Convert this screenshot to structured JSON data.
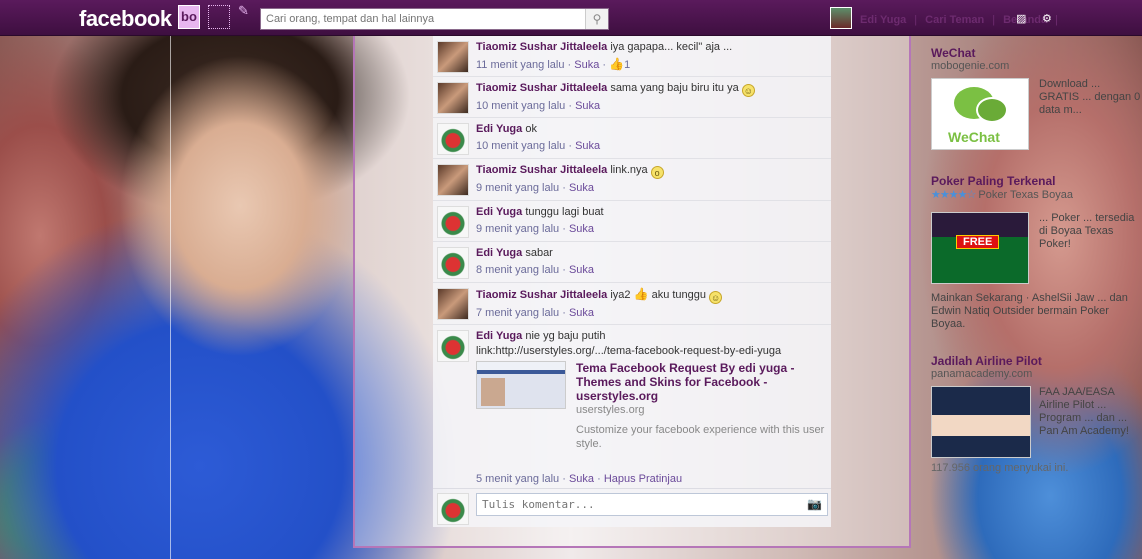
{
  "topbar": {
    "logo": "facebook",
    "friend_jewel": "bo",
    "search_placeholder": "Cari orang, tempat dan hal lainnya",
    "user_name": "Edi Yuga",
    "nav_find_friends": "Cari Teman",
    "nav_home": "Beranda",
    "icons": [
      "friend-requests-icon",
      "messages-icon",
      "notifications-icon",
      "search-icon",
      "privacy-icon",
      "settings-icon"
    ]
  },
  "comments": [
    {
      "author": "Tiaomiz Sushar Jittaleela",
      "text": "iya gapapa... kecil\" aja ...",
      "time": "11 menit yang lalu",
      "like": "Suka",
      "likes": "1",
      "avatar": "t"
    },
    {
      "author": "Tiaomiz Sushar Jittaleela",
      "text": "sama yang baju biru itu ya",
      "time": "10 menit yang lalu",
      "like": "Suka",
      "avatar": "t"
    },
    {
      "author": "Edi Yuga",
      "text": "ok",
      "time": "10 menit yang lalu",
      "like": "Suka",
      "avatar": "e"
    },
    {
      "author": "Tiaomiz Sushar Jittaleela",
      "text": "link.nya",
      "time": "9 menit yang lalu",
      "like": "Suka",
      "avatar": "t"
    },
    {
      "author": "Edi Yuga",
      "text": "tunggu lagi buat",
      "time": "9 menit yang lalu",
      "like": "Suka",
      "avatar": "e"
    },
    {
      "author": "Edi Yuga",
      "text": "sabar",
      "time": "8 menit yang lalu",
      "like": "Suka",
      "avatar": "e"
    },
    {
      "author": "Tiaomiz Sushar Jittaleela",
      "text": "iya2",
      "text2": "aku tunggu",
      "time": "7 menit yang lalu",
      "like": "Suka",
      "avatar": "t"
    },
    {
      "author": "Edi Yuga",
      "text": "nie yg baju putih",
      "link_text": "link:http://userstyles.org/.../tema-facebook-request-by-edi-yuga",
      "time": "5 menit yang lalu",
      "like": "Suka",
      "remove_preview": "Hapus Pratinjau",
      "avatar": "e",
      "preview": {
        "title": "Tema Facebook Request By edi yuga - Themes and Skins for Facebook - userstyles.org",
        "domain": "userstyles.org",
        "description": "Customize your facebook experience with this user style."
      }
    }
  ],
  "composer": {
    "placeholder": "Tulis komentar..."
  },
  "sidebar": {
    "ads": [
      {
        "title": "WeChat",
        "subtitle": "mobogenie.com",
        "image_label": "WeChat",
        "text": "Download ... GRATIS ... dengan 0 data m..."
      },
      {
        "title": "Poker Paling Terkenal",
        "subtitle": "Poker Texas Boyaa",
        "rating": "4",
        "image_label": "FREE",
        "text": "... Poker ... tersedia di Boyaa Texas Poker!"
      },
      {
        "title": "Jadilah Airline Pilot",
        "subtitle": "panamacademy.com",
        "text": "FAA JAA/EASA Airline Pilot ... Program ... dan ... Pan Am Academy!",
        "footer": "117.956 orang menyukai ini."
      }
    ],
    "social_line": "Mainkan Sekarang · AshelSii Jaw ... dan Edwin Natiq Outsider bermain Poker Boyaa."
  },
  "colors": {
    "topbar": "#4b154d",
    "author": "#5a1a5c",
    "frame_border": "#b576b8"
  }
}
